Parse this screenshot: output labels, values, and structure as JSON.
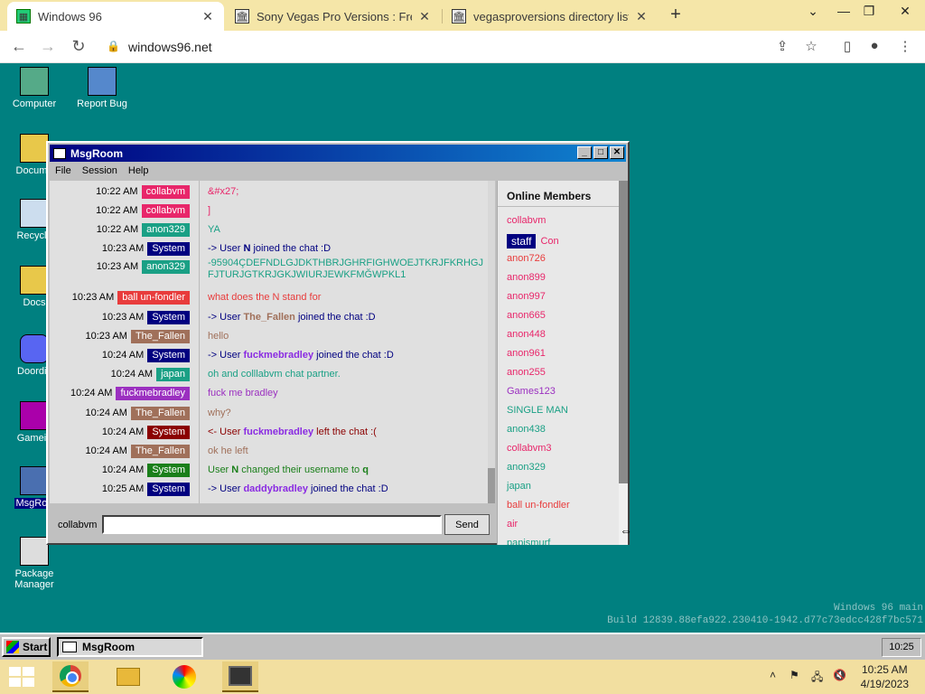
{
  "browser": {
    "tabs": [
      {
        "title": "Windows 96",
        "active": true
      },
      {
        "title": "Sony Vegas Pro Versions : Free D",
        "active": false
      },
      {
        "title": "vegasproversions directory listing",
        "active": false
      }
    ],
    "url": "windows96.net"
  },
  "desktop": {
    "icons": [
      {
        "label": "Computer"
      },
      {
        "label": "Report Bug"
      },
      {
        "label": "Docume"
      },
      {
        "label": "Recycle"
      },
      {
        "label": "Docs"
      },
      {
        "label": "Doordis"
      },
      {
        "label": "Gamein"
      },
      {
        "label": "MsgRoo"
      },
      {
        "label": "Package Manager"
      }
    ],
    "build_line1": "Windows 96 main",
    "build_line2": "Build 12839.88efa922.230410-1942.d77c73edcc428f7bc571"
  },
  "msgroom": {
    "title": "MsgRoom",
    "menu": [
      "File",
      "Session",
      "Help"
    ],
    "messages": [
      {
        "time": "10:22 AM",
        "user": "collabvm",
        "ucolor": "#e8266a",
        "text": "&#x27;",
        "tcolor": "#e8266a"
      },
      {
        "time": "10:22 AM",
        "user": "collabvm",
        "ucolor": "#e8266a",
        "text": "]",
        "tcolor": "#e8266a"
      },
      {
        "time": "10:22 AM",
        "user": "anon329",
        "ucolor": "#1aa085",
        "text": "YA",
        "tcolor": "#1aa085"
      },
      {
        "time": "10:23 AM",
        "user": "System",
        "ucolor": "#000080",
        "text_pre": "-> User ",
        "text_name": "N",
        "name_color": "#000080",
        "text_post": " joined the chat :D",
        "tcolor": "#000080"
      },
      {
        "time": "10:23 AM",
        "user": "anon329",
        "ucolor": "#1aa085",
        "text": "-95904ÇDEFNDLGJDKTHBRJGHRFIGHWOEJTKRJFKRHGJFJTURJGTKRJGKJWIURJEWKFMĞWPKL1",
        "tcolor": "#1aa085"
      },
      {
        "time": "10:23 AM",
        "user": "ball un-fondler",
        "ucolor": "#e83c3c",
        "text": "what does the N stand for",
        "tcolor": "#e83c3c"
      },
      {
        "time": "10:23 AM",
        "user": "System",
        "ucolor": "#000080",
        "text_pre": "-> User ",
        "text_name": "The_Fallen",
        "name_color": "#a0705a",
        "text_post": " joined the chat :D",
        "tcolor": "#000080"
      },
      {
        "time": "10:23 AM",
        "user": "The_Fallen",
        "ucolor": "#a0705a",
        "text": "hello",
        "tcolor": "#a0705a"
      },
      {
        "time": "10:24 AM",
        "user": "System",
        "ucolor": "#000080",
        "text_pre": "-> User ",
        "text_name": "fuckmebradley",
        "name_color": "#8a2be2",
        "text_post": " joined the chat :D",
        "tcolor": "#000080"
      },
      {
        "time": "10:24 AM",
        "user": "japan",
        "ucolor": "#1aa085",
        "text": "oh and colllabvm chat partner.",
        "tcolor": "#1aa085"
      },
      {
        "time": "10:24 AM",
        "user": "fuckmebradley",
        "ucolor": "#9b30c0",
        "text": "fuck me bradley",
        "tcolor": "#9b30c0"
      },
      {
        "time": "10:24 AM",
        "user": "The_Fallen",
        "ucolor": "#a0705a",
        "text": "why?",
        "tcolor": "#a0705a"
      },
      {
        "time": "10:24 AM",
        "user": "System",
        "ucolor": "#8b0000",
        "text_pre": "<- User ",
        "text_name": "fuckmebradley",
        "name_color": "#8a2be2",
        "text_post": " left the chat :(",
        "tcolor": "#8b0000"
      },
      {
        "time": "10:24 AM",
        "user": "The_Fallen",
        "ucolor": "#a0705a",
        "text": "ok he left",
        "tcolor": "#a0705a"
      },
      {
        "time": "10:24 AM",
        "user": "System",
        "ucolor": "#1a7f1a",
        "text_pre": "User ",
        "text_name": "N",
        "name_color": "#1a7f1a",
        "text_post": " changed their username to ",
        "text_name2": "q",
        "tcolor": "#1a7f1a"
      },
      {
        "time": "10:25 AM",
        "user": "System",
        "ucolor": "#000080",
        "text_pre": "-> User ",
        "text_name": "daddybradley",
        "name_color": "#8a2be2",
        "text_post": " joined the chat :D",
        "tcolor": "#000080"
      }
    ],
    "members_title": "Online Members",
    "members": [
      {
        "name": "collabvm",
        "color": "#e8266a"
      },
      {
        "name": "Con",
        "color": "#e8266a",
        "staff": "staff"
      },
      {
        "name": "anon726",
        "color": "#e83c3c"
      },
      {
        "name": "anon899",
        "color": "#e8266a"
      },
      {
        "name": "anon997",
        "color": "#e8266a"
      },
      {
        "name": "anon665",
        "color": "#e8266a"
      },
      {
        "name": "anon448",
        "color": "#e8266a"
      },
      {
        "name": "anon961",
        "color": "#e8266a"
      },
      {
        "name": "anon255",
        "color": "#e8266a"
      },
      {
        "name": "Games123",
        "color": "#9b30c0"
      },
      {
        "name": "SINGLE MAN",
        "color": "#1aa085"
      },
      {
        "name": "anon438",
        "color": "#1aa085"
      },
      {
        "name": "collabvm3",
        "color": "#e8266a"
      },
      {
        "name": "anon329",
        "color": "#1aa085"
      },
      {
        "name": "japan",
        "color": "#1aa085"
      },
      {
        "name": "ball un-fondler",
        "color": "#e83c3c"
      },
      {
        "name": "air",
        "color": "#e8266a"
      },
      {
        "name": "papismurf",
        "color": "#1aa085"
      }
    ],
    "username": "collabvm",
    "input_value": "",
    "send_label": "Send"
  },
  "w96taskbar": {
    "start_label": "Start",
    "task_label": "MsgRoom",
    "clock": "10:25"
  },
  "systray": {
    "time": "10:25 AM",
    "date": "4/19/2023"
  }
}
